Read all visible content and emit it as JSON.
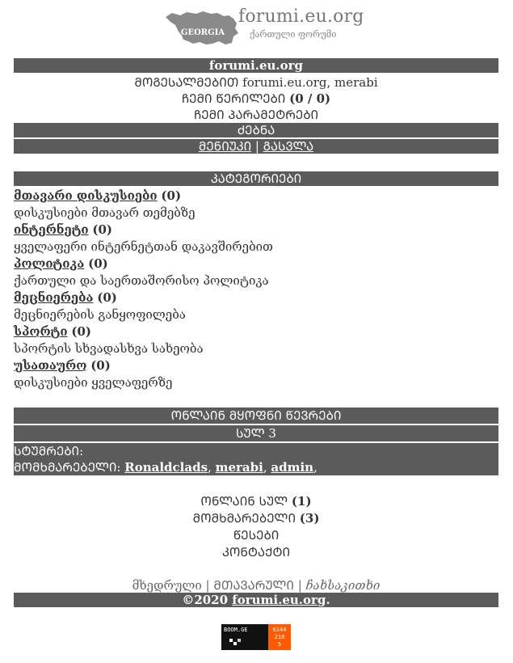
{
  "header": {
    "map_label": "GEORGIA",
    "site_title": "forumi.eu.org",
    "site_subtitle": "ქართული ფორუმი"
  },
  "top_bar": {
    "title": "forumi.eu.org"
  },
  "welcome": {
    "prefix": "ᲛᲝᲒᲔᲡᲐᲚᲛᲔᲑᲘᲗ",
    "site": "forumi.eu.org",
    "user": "merabi"
  },
  "messages": {
    "label": "ᲩᲔᲛᲘ ᲬᲔᲠᲘᲚᲔᲑᲘ",
    "count": "(0 / 0)"
  },
  "my_settings": "ᲩᲔᲛᲘ ᲞᲐᲠᲐᲛᲔᲢᲠᲔᲑᲘ",
  "search_bar": "ᲫᲔᲑᲜᲐ",
  "auth": {
    "register": "ᲛᲔᲜᲘᲣᲙᲘ",
    "separator": "|",
    "logout": "ᲒᲐᲡᲕᲚᲐ"
  },
  "categories": {
    "header": "ᲙᲐᲢᲔᲒᲝᲠᲘᲔᲑᲘ",
    "items": [
      {
        "title": "მთავარი დისკუსიები",
        "count": "(0)",
        "desc": "დისკუსიები მთავარ თემებზე"
      },
      {
        "title": "ინტერნეტი",
        "count": "(0)",
        "desc": "ყველაფერი ინტერნეტთან დაკავშირებით"
      },
      {
        "title": "პოლიტიკა",
        "count": "(0)",
        "desc": "ქართული და საერთაშორისო პოლიტიკა"
      },
      {
        "title": "მეცნიერება",
        "count": "(0)",
        "desc": "მეცნიერების განყოფილება"
      },
      {
        "title": "სპორტი",
        "count": "(0)",
        "desc": "სპორტის სხვადასხვა სახეობა"
      },
      {
        "title": "უსათაურო",
        "count": "(0)",
        "desc": "დისკუსიები ყველაფერზე"
      }
    ]
  },
  "online": {
    "header": "ᲝᲜᲚᲐᲘᲜ ᲛᲧᲝᲤᲜᲘ ᲬᲔᲕᲠᲔᲑᲘ",
    "sub_header": "ᲡᲣᲚ 3",
    "guests_label": "ᲡᲢᲣᲛᲠᲔᲑᲘ:",
    "members_label": "ᲛᲝᲛᲮᲛᲐᲠᲔᲑᲔᲚᲘ:",
    "members": [
      "Ronaldclads",
      "merabi",
      "admin"
    ],
    "members_trailing": ","
  },
  "footer_links": {
    "online_label": "ᲝᲜᲚᲐᲘᲜ ᲡᲣᲚ",
    "online_count": "(1)",
    "members_label": "ᲛᲝᲛᲮᲛᲐᲠᲔᲑᲔᲚᲘ",
    "members_count": "(3)",
    "rules": "ᲬᲔᲡᲔᲑᲘ",
    "contact": "ᲙᲝᲜᲢᲐᲥᲢᲘ"
  },
  "languages": {
    "georgian": "მხედრული",
    "latin": "ᲛᲗᲐᲕᲐᲠᲣᲚᲘ",
    "other": "ჩახსაკითხი",
    "sep": "|"
  },
  "copyright": {
    "text": "©2020",
    "link": "forumi.eu.org",
    "trail": "."
  },
  "counter": {
    "brand": "BOOM.GE",
    "n1": "6144",
    "n2": "218",
    "n3": "5"
  },
  "colors": {
    "bar": "#5b5b5b",
    "text": "#333333",
    "counter_orange": "#ff5a00"
  }
}
